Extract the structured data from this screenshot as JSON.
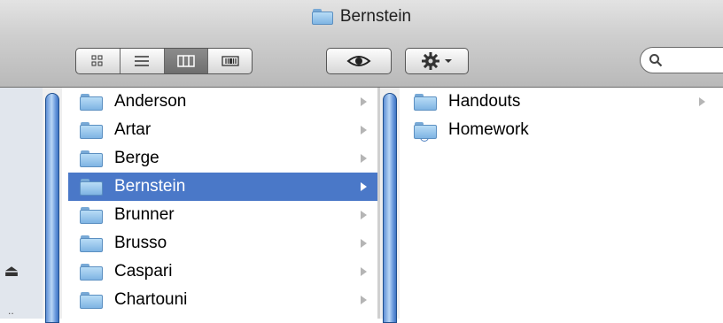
{
  "window": {
    "title": "Bernstein"
  },
  "toolbar": {
    "view_modes": [
      {
        "name": "icon-view",
        "icon": "grid-icon",
        "active": false
      },
      {
        "name": "list-view",
        "icon": "list-icon",
        "active": false
      },
      {
        "name": "column-view",
        "icon": "columns-icon",
        "active": true
      },
      {
        "name": "coverflow-view",
        "icon": "coverflow-icon",
        "active": false
      }
    ],
    "quicklook_icon": "eye-icon",
    "action_icon": "gear-icon",
    "search_icon": "magnifier-icon"
  },
  "sidebar": {
    "eject_icon": "eject-icon",
    "eject_glyph": "⏏",
    "more_text": ".."
  },
  "column1": {
    "items": [
      {
        "label": "Anderson"
      },
      {
        "label": "Artar"
      },
      {
        "label": "Berge"
      },
      {
        "label": "Bernstein",
        "selected": true
      },
      {
        "label": "Brunner"
      },
      {
        "label": "Brusso"
      },
      {
        "label": "Caspari"
      },
      {
        "label": "Chartouni"
      }
    ]
  },
  "column2": {
    "items": [
      {
        "label": "Handouts",
        "has_children": true
      },
      {
        "label": "Homework",
        "has_children": false,
        "badge": "dropbox"
      }
    ]
  },
  "colors": {
    "selection": "#4a78c8",
    "folder": "#8dbfe9",
    "scroll_thumb": "#5e8fd5"
  }
}
